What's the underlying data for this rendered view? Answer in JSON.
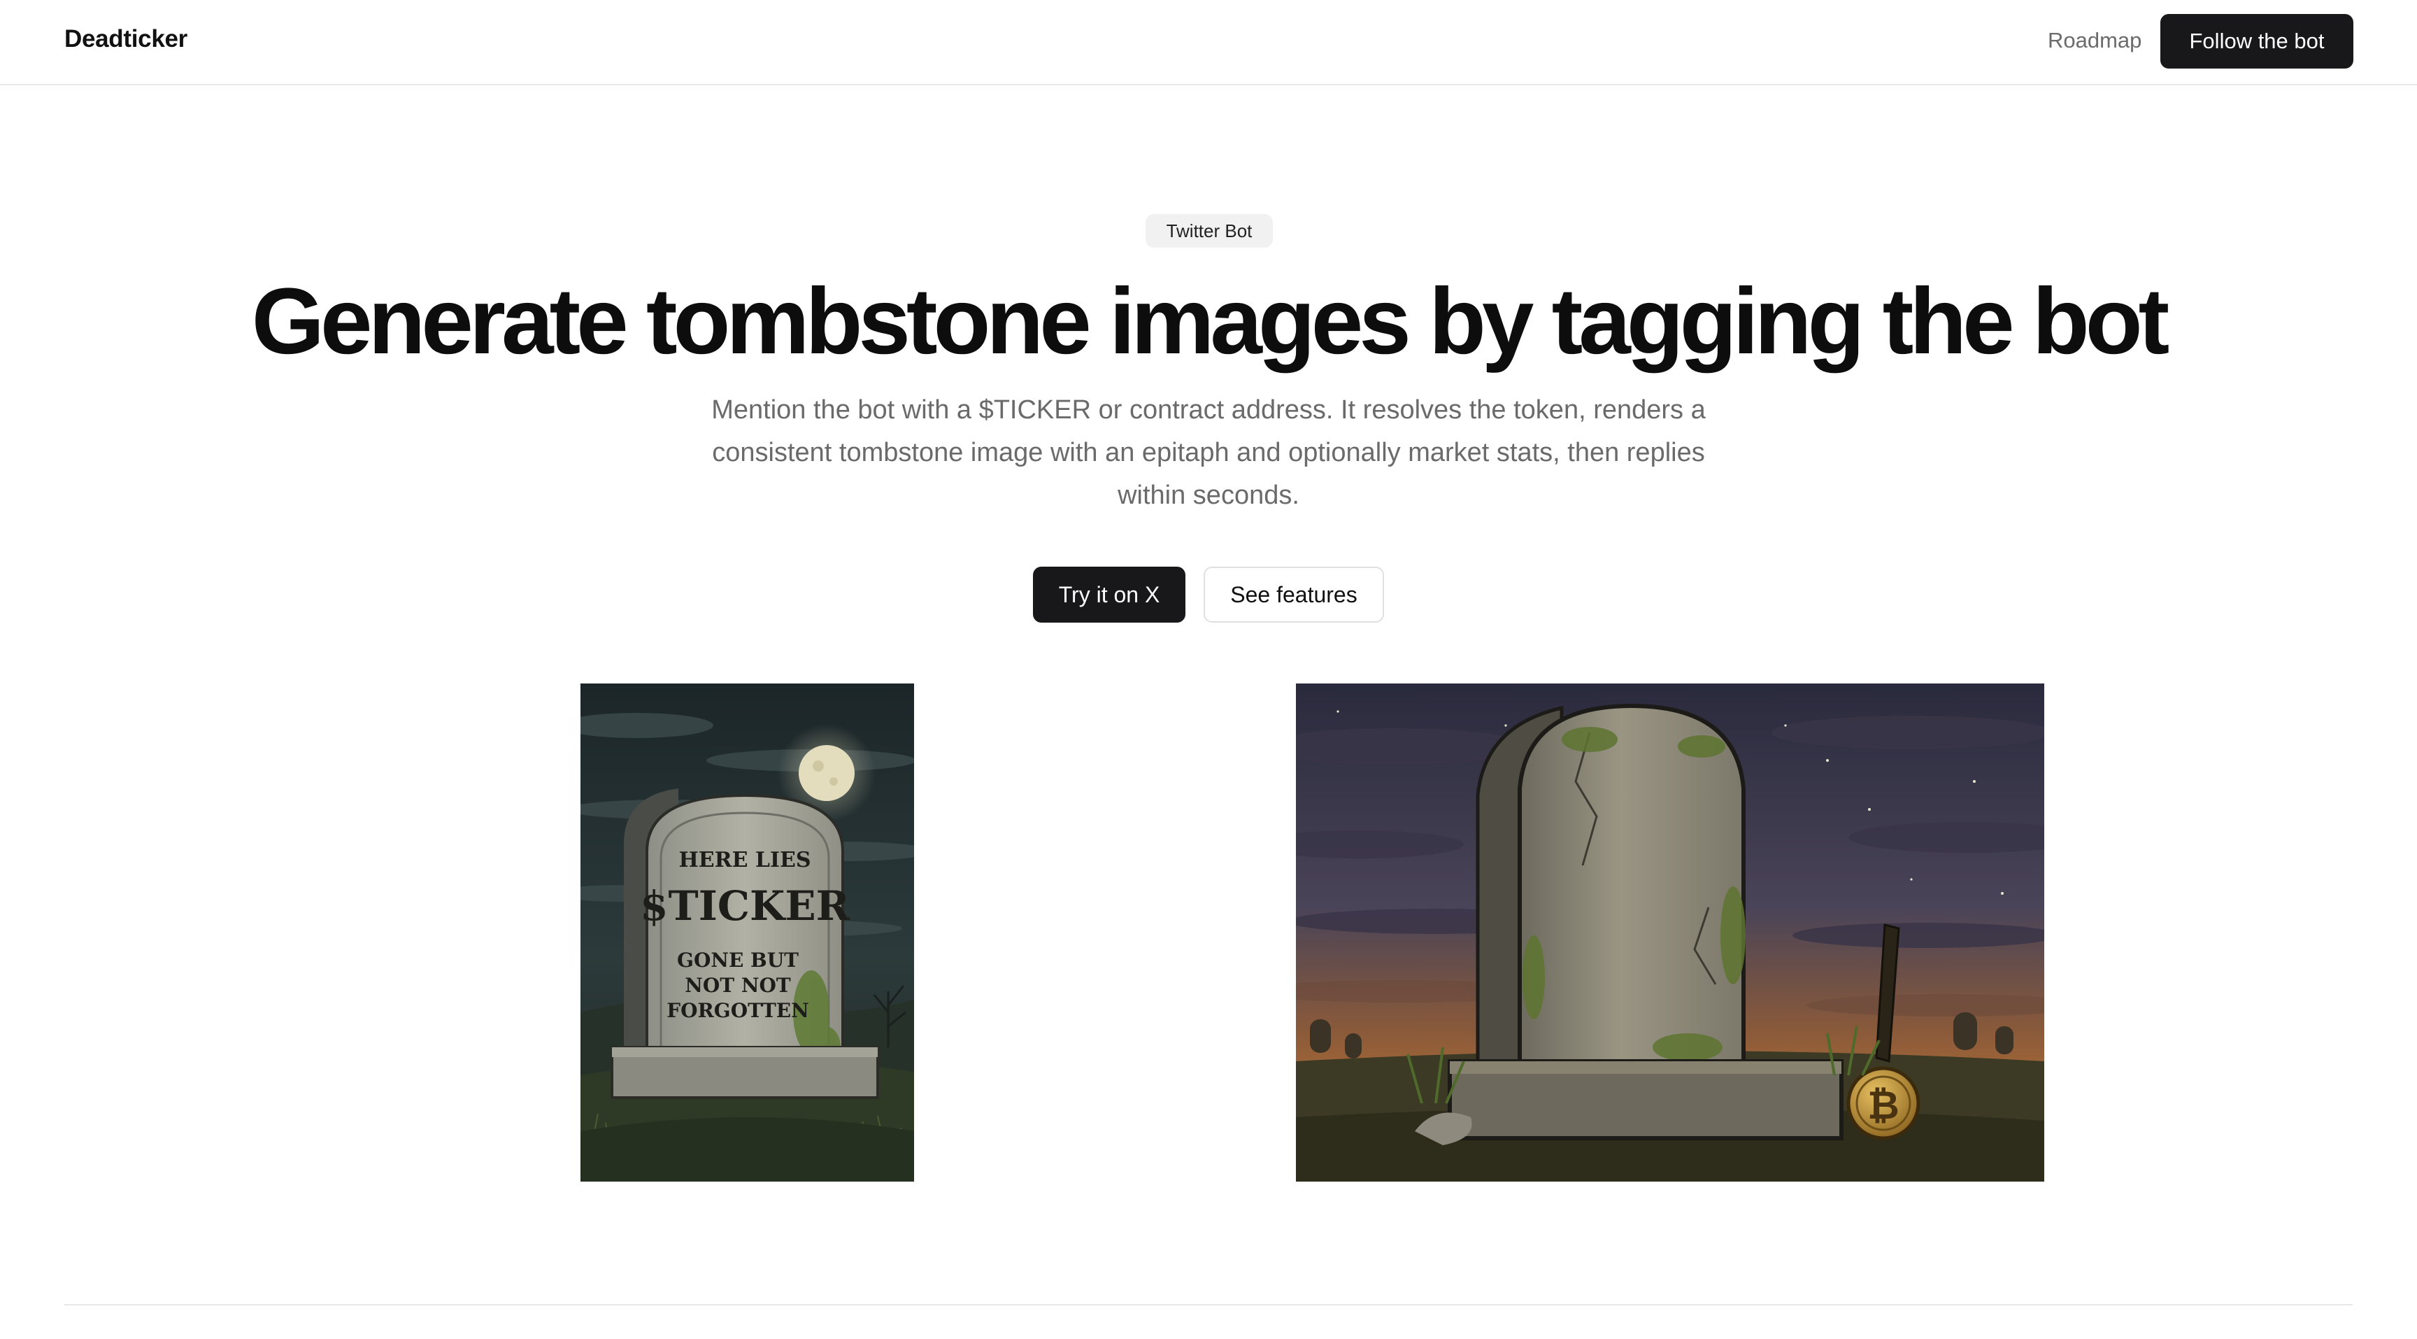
{
  "nav": {
    "brand": "Deadticker",
    "roadmap_label": "Roadmap",
    "follow_label": "Follow the bot"
  },
  "hero": {
    "badge": "Twitter Bot",
    "title": "Generate tombstone images by tagging the bot",
    "subtitle": "Mention the bot with a $TICKER or contract address. It resolves the token, renders a consistent tombstone image with an epitaph and optionally market stats, then replies within seconds.",
    "primary_cta": "Try it on X",
    "secondary_cta": "See features"
  },
  "examples": {
    "left": {
      "line1": "HERE LIES",
      "line2": "$TICKER",
      "line3": "GONE BUT",
      "line4": "NOT NOT",
      "line5": "FORGOTTEN"
    },
    "right": {
      "coin_symbol": "₿"
    }
  },
  "colors": {
    "primary_button": "#18181a",
    "muted_text": "#6a6a6a",
    "divider": "#e7e7e7"
  }
}
